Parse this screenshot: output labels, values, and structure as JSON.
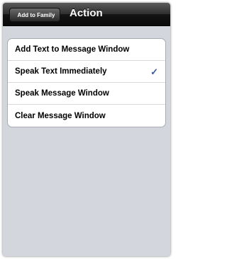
{
  "navbar": {
    "back_label": "Add to Family",
    "title": "Action"
  },
  "list": {
    "items": [
      {
        "label": "Add Text to Message Window",
        "checked": false
      },
      {
        "label": "Speak Text Immediately",
        "checked": true
      },
      {
        "label": "Speak Message Window",
        "checked": false
      },
      {
        "label": "Clear Message Window",
        "checked": false
      }
    ],
    "check_glyph": "✓"
  }
}
